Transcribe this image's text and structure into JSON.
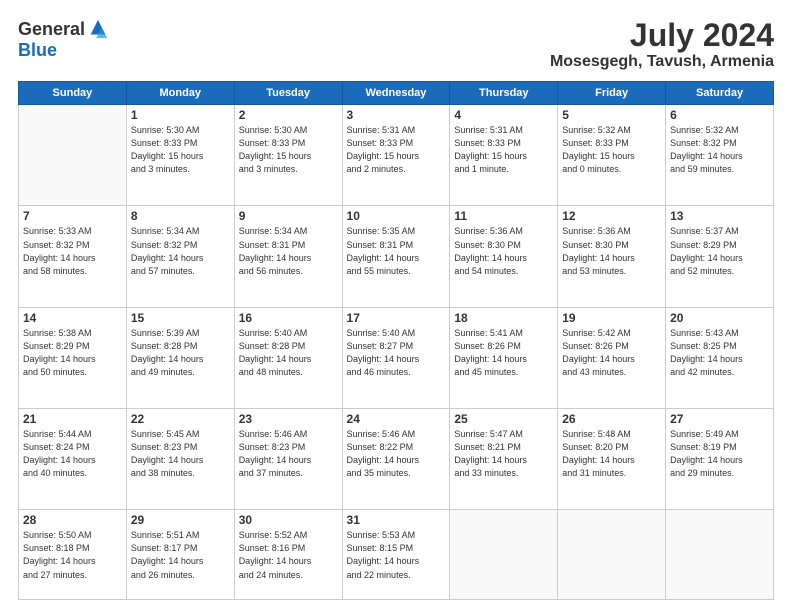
{
  "header": {
    "logo_general": "General",
    "logo_blue": "Blue",
    "month_year": "July 2024",
    "location": "Mosesgegh, Tavush, Armenia"
  },
  "days_of_week": [
    "Sunday",
    "Monday",
    "Tuesday",
    "Wednesday",
    "Thursday",
    "Friday",
    "Saturday"
  ],
  "weeks": [
    [
      {
        "day": "",
        "info": ""
      },
      {
        "day": "1",
        "info": "Sunrise: 5:30 AM\nSunset: 8:33 PM\nDaylight: 15 hours\nand 3 minutes."
      },
      {
        "day": "2",
        "info": "Sunrise: 5:30 AM\nSunset: 8:33 PM\nDaylight: 15 hours\nand 3 minutes."
      },
      {
        "day": "3",
        "info": "Sunrise: 5:31 AM\nSunset: 8:33 PM\nDaylight: 15 hours\nand 2 minutes."
      },
      {
        "day": "4",
        "info": "Sunrise: 5:31 AM\nSunset: 8:33 PM\nDaylight: 15 hours\nand 1 minute."
      },
      {
        "day": "5",
        "info": "Sunrise: 5:32 AM\nSunset: 8:33 PM\nDaylight: 15 hours\nand 0 minutes."
      },
      {
        "day": "6",
        "info": "Sunrise: 5:32 AM\nSunset: 8:32 PM\nDaylight: 14 hours\nand 59 minutes."
      }
    ],
    [
      {
        "day": "7",
        "info": "Sunrise: 5:33 AM\nSunset: 8:32 PM\nDaylight: 14 hours\nand 58 minutes."
      },
      {
        "day": "8",
        "info": "Sunrise: 5:34 AM\nSunset: 8:32 PM\nDaylight: 14 hours\nand 57 minutes."
      },
      {
        "day": "9",
        "info": "Sunrise: 5:34 AM\nSunset: 8:31 PM\nDaylight: 14 hours\nand 56 minutes."
      },
      {
        "day": "10",
        "info": "Sunrise: 5:35 AM\nSunset: 8:31 PM\nDaylight: 14 hours\nand 55 minutes."
      },
      {
        "day": "11",
        "info": "Sunrise: 5:36 AM\nSunset: 8:30 PM\nDaylight: 14 hours\nand 54 minutes."
      },
      {
        "day": "12",
        "info": "Sunrise: 5:36 AM\nSunset: 8:30 PM\nDaylight: 14 hours\nand 53 minutes."
      },
      {
        "day": "13",
        "info": "Sunrise: 5:37 AM\nSunset: 8:29 PM\nDaylight: 14 hours\nand 52 minutes."
      }
    ],
    [
      {
        "day": "14",
        "info": "Sunrise: 5:38 AM\nSunset: 8:29 PM\nDaylight: 14 hours\nand 50 minutes."
      },
      {
        "day": "15",
        "info": "Sunrise: 5:39 AM\nSunset: 8:28 PM\nDaylight: 14 hours\nand 49 minutes."
      },
      {
        "day": "16",
        "info": "Sunrise: 5:40 AM\nSunset: 8:28 PM\nDaylight: 14 hours\nand 48 minutes."
      },
      {
        "day": "17",
        "info": "Sunrise: 5:40 AM\nSunset: 8:27 PM\nDaylight: 14 hours\nand 46 minutes."
      },
      {
        "day": "18",
        "info": "Sunrise: 5:41 AM\nSunset: 8:26 PM\nDaylight: 14 hours\nand 45 minutes."
      },
      {
        "day": "19",
        "info": "Sunrise: 5:42 AM\nSunset: 8:26 PM\nDaylight: 14 hours\nand 43 minutes."
      },
      {
        "day": "20",
        "info": "Sunrise: 5:43 AM\nSunset: 8:25 PM\nDaylight: 14 hours\nand 42 minutes."
      }
    ],
    [
      {
        "day": "21",
        "info": "Sunrise: 5:44 AM\nSunset: 8:24 PM\nDaylight: 14 hours\nand 40 minutes."
      },
      {
        "day": "22",
        "info": "Sunrise: 5:45 AM\nSunset: 8:23 PM\nDaylight: 14 hours\nand 38 minutes."
      },
      {
        "day": "23",
        "info": "Sunrise: 5:46 AM\nSunset: 8:23 PM\nDaylight: 14 hours\nand 37 minutes."
      },
      {
        "day": "24",
        "info": "Sunrise: 5:46 AM\nSunset: 8:22 PM\nDaylight: 14 hours\nand 35 minutes."
      },
      {
        "day": "25",
        "info": "Sunrise: 5:47 AM\nSunset: 8:21 PM\nDaylight: 14 hours\nand 33 minutes."
      },
      {
        "day": "26",
        "info": "Sunrise: 5:48 AM\nSunset: 8:20 PM\nDaylight: 14 hours\nand 31 minutes."
      },
      {
        "day": "27",
        "info": "Sunrise: 5:49 AM\nSunset: 8:19 PM\nDaylight: 14 hours\nand 29 minutes."
      }
    ],
    [
      {
        "day": "28",
        "info": "Sunrise: 5:50 AM\nSunset: 8:18 PM\nDaylight: 14 hours\nand 27 minutes."
      },
      {
        "day": "29",
        "info": "Sunrise: 5:51 AM\nSunset: 8:17 PM\nDaylight: 14 hours\nand 26 minutes."
      },
      {
        "day": "30",
        "info": "Sunrise: 5:52 AM\nSunset: 8:16 PM\nDaylight: 14 hours\nand 24 minutes."
      },
      {
        "day": "31",
        "info": "Sunrise: 5:53 AM\nSunset: 8:15 PM\nDaylight: 14 hours\nand 22 minutes."
      },
      {
        "day": "",
        "info": ""
      },
      {
        "day": "",
        "info": ""
      },
      {
        "day": "",
        "info": ""
      }
    ]
  ]
}
